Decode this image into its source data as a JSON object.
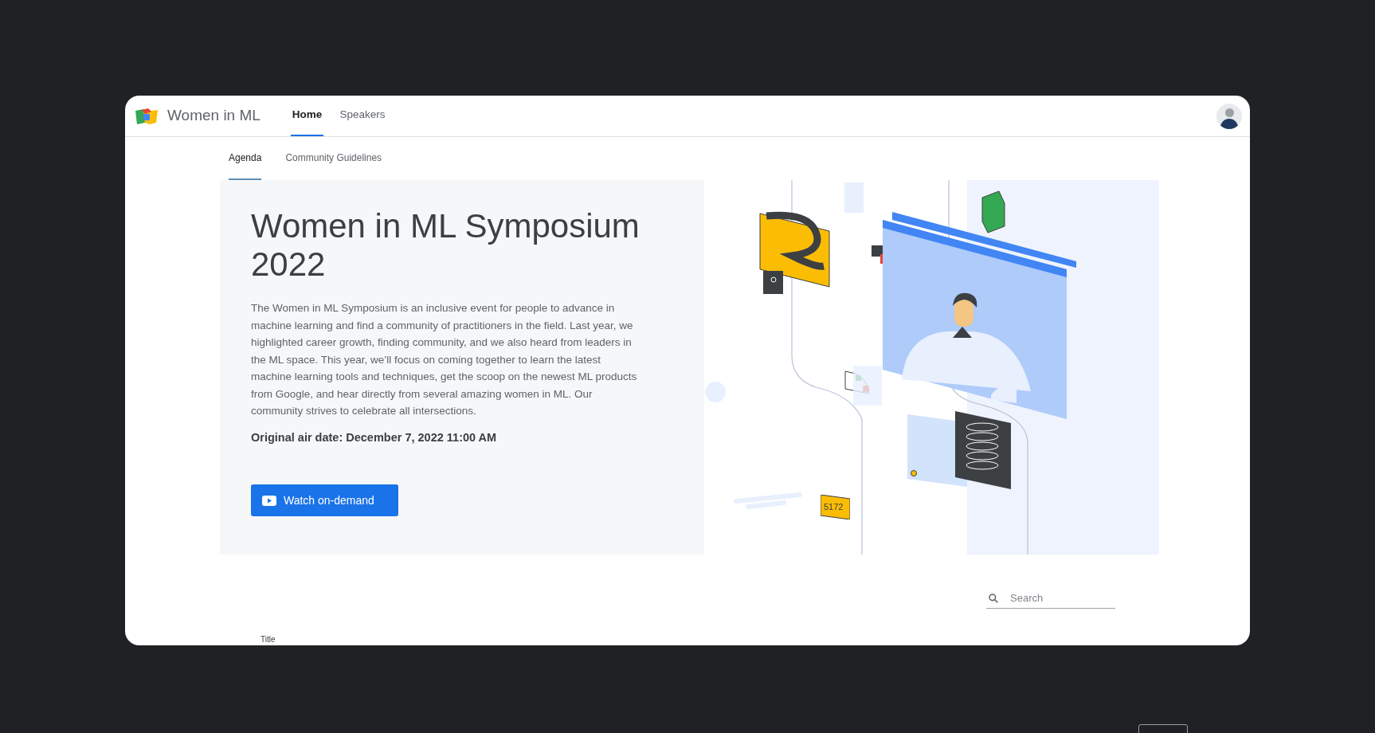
{
  "header": {
    "logo_text": "Women in ML",
    "nav": [
      {
        "label": "Home",
        "selected": true
      },
      {
        "label": "Speakers",
        "selected": false
      }
    ]
  },
  "subnav": [
    {
      "label": "Agenda",
      "selected": true
    },
    {
      "label": "Community Guidelines",
      "selected": false
    }
  ],
  "hero": {
    "title": "Women in ML Symposium 2022",
    "description": "The Women in ML Symposium is an inclusive event for people to advance in machine learning and find a community of practitioners in the field. Last year, we highlighted career growth, finding community, and we also heard from leaders in the ML space. This year, we’ll focus on coming together to learn the latest machine learning tools and techniques, get the scoop on the newest ML products from Google, and hear directly from several amazing women in ML. Our community strives to celebrate all intersections.",
    "air_date": "Original air date: December 7, 2022 11:00 AM",
    "button": "Watch on-demand"
  },
  "illustration": {
    "badge": "5172"
  },
  "search": {
    "placeholder": "Search"
  },
  "table": {
    "columns": [
      "Title"
    ]
  }
}
